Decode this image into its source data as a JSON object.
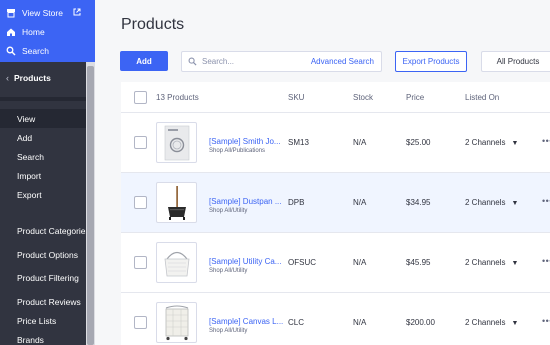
{
  "sidebar": {
    "top": [
      {
        "label": "View Store",
        "icon": "store-icon"
      },
      {
        "label": "Home",
        "icon": "home-icon"
      },
      {
        "label": "Search",
        "icon": "search-icon"
      }
    ],
    "section_title": "Products",
    "items": [
      {
        "label": "View",
        "active": true
      },
      {
        "label": "Add"
      },
      {
        "label": "Search"
      },
      {
        "label": "Import"
      },
      {
        "label": "Export"
      },
      {
        "label": "Product Categories"
      },
      {
        "label": "Product Options"
      },
      {
        "label": "Product Filtering"
      },
      {
        "label": "Product Reviews"
      },
      {
        "label": "Price Lists"
      },
      {
        "label": "Brands"
      }
    ]
  },
  "page": {
    "title": "Products",
    "add_label": "Add",
    "search_placeholder": "Search...",
    "advanced_search_label": "Advanced Search",
    "export_label": "Export Products",
    "filter_label": "All Products"
  },
  "table": {
    "headers": {
      "count": "13 Products",
      "sku": "SKU",
      "stock": "Stock",
      "price": "Price",
      "listed_on": "Listed On"
    },
    "rows": [
      {
        "name": "[Sample] Smith Jo...",
        "category": "Shop All/Publications",
        "sku": "SM13",
        "stock": "N/A",
        "price": "$25.00",
        "listed": "2 Channels"
      },
      {
        "name": "[Sample] Dustpan ...",
        "category": "Shop All/Utility",
        "sku": "DPB",
        "stock": "N/A",
        "price": "$34.95",
        "listed": "2 Channels"
      },
      {
        "name": "[Sample] Utility Ca...",
        "category": "Shop All/Utility",
        "sku": "OFSUC",
        "stock": "N/A",
        "price": "$45.95",
        "listed": "2 Channels"
      },
      {
        "name": "[Sample] Canvas L...",
        "category": "Shop All/Utility",
        "sku": "CLC",
        "stock": "N/A",
        "price": "$200.00",
        "listed": "2 Channels"
      }
    ]
  },
  "colors": {
    "accent": "#3c64f4",
    "sidebar": "#313440",
    "row_highlight": "#f0f5ff"
  }
}
